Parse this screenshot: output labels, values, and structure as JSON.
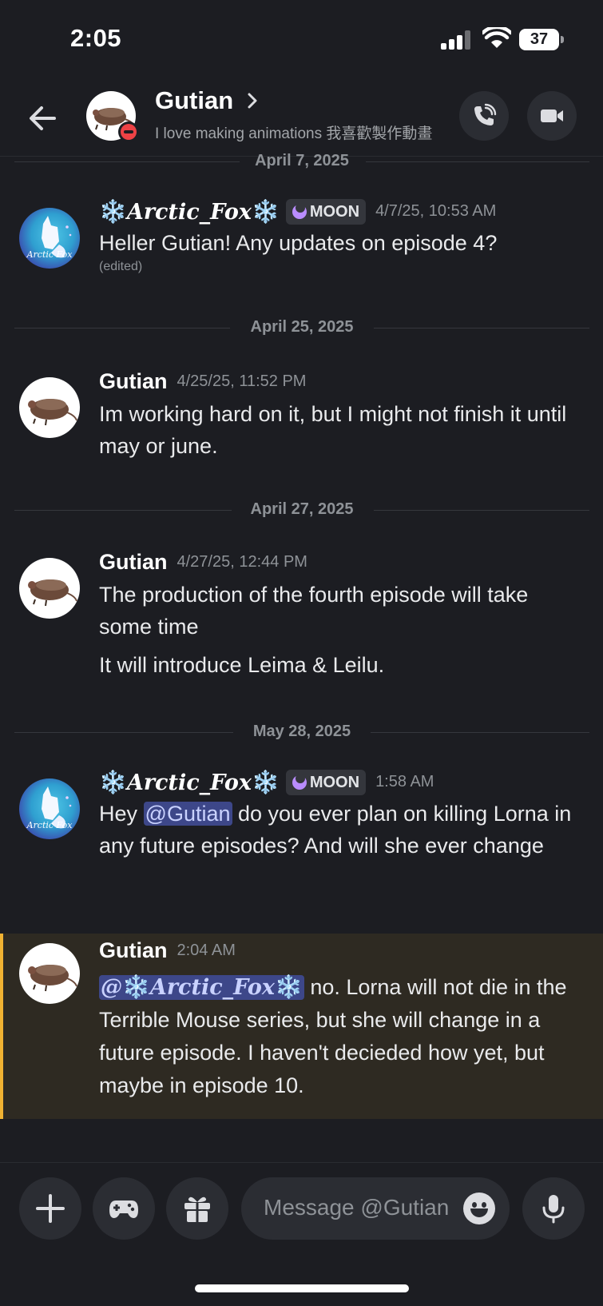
{
  "status_bar": {
    "time": "2:05",
    "battery": "37"
  },
  "header": {
    "name": "Gutian",
    "status": "I love making animations 我喜歡製作動畫",
    "icons": {
      "back": "back-arrow-icon",
      "chevron": "chevron-right-icon",
      "call": "phone-call-icon",
      "video": "video-camera-icon"
    }
  },
  "date_separators": [
    "April 7, 2025",
    "April 25, 2025",
    "April 27, 2025",
    "May 28, 2025"
  ],
  "messages": [
    {
      "author": "Arctic_Fox",
      "author_decoration": "❄️",
      "badge": "MOON",
      "timestamp": "4/7/25, 10:53 AM",
      "lines": [
        "Heller Gutian! Any updates on episode 4?"
      ],
      "edited": "(edited)"
    },
    {
      "author": "Gutian",
      "timestamp": "4/25/25, 11:52 PM",
      "lines": [
        "Im working hard on it, but I might not finish it until may or june."
      ]
    },
    {
      "author": "Gutian",
      "timestamp": "4/27/25, 12:44 PM",
      "lines": [
        "The production of the fourth episode will take some time",
        "It will introduce Leima & Leilu."
      ]
    },
    {
      "author": "Arctic_Fox",
      "author_decoration": "❄️",
      "badge": "MOON",
      "timestamp": "1:58 AM",
      "prefix": "Hey ",
      "mention": "@Gutian",
      "text": " do you ever plan on killing Lorna in any future episodes? And will she ever change"
    },
    {
      "author": "Gutian",
      "timestamp": "2:04 AM",
      "mention_prefix": "@",
      "mention_name": "Arctic_Fox",
      "text": " no. Lorna will not die in the Terrible Mouse series, but she will change in a future episode. I haven't decieded how yet, but maybe in episode 10."
    }
  ],
  "composer": {
    "placeholder": "Message @Gutian",
    "icons": [
      "plus-icon",
      "gamepad-icon",
      "gift-icon",
      "emoji-icon",
      "microphone-icon"
    ]
  },
  "colors": {
    "background": "#1c1d22",
    "mention": "#3d4789",
    "highlight": "#2e2a22",
    "highlight_bar": "#f0b232",
    "dnd": "#ed4245"
  }
}
